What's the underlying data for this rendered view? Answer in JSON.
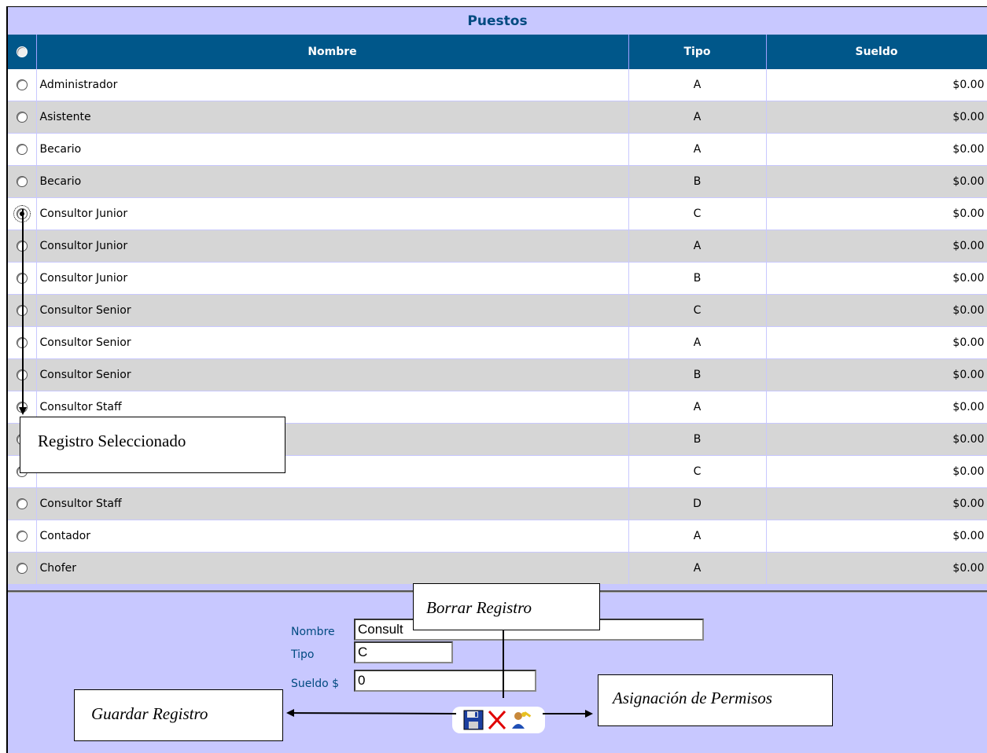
{
  "title": "Puestos",
  "columns": {
    "nombre": "Nombre",
    "tipo": "Tipo",
    "sueldo": "Sueldo"
  },
  "rows": [
    {
      "nombre": "Administrador",
      "tipo": "A",
      "sueldo": "$0.00"
    },
    {
      "nombre": "Asistente",
      "tipo": "A",
      "sueldo": "$0.00"
    },
    {
      "nombre": "Becario",
      "tipo": "A",
      "sueldo": "$0.00"
    },
    {
      "nombre": "Becario",
      "tipo": "B",
      "sueldo": "$0.00"
    },
    {
      "nombre": "Consultor Junior",
      "tipo": "C",
      "sueldo": "$0.00",
      "selected": true
    },
    {
      "nombre": "Consultor Junior",
      "tipo": "A",
      "sueldo": "$0.00"
    },
    {
      "nombre": "Consultor Junior",
      "tipo": "B",
      "sueldo": "$0.00"
    },
    {
      "nombre": "Consultor Senior",
      "tipo": "C",
      "sueldo": "$0.00"
    },
    {
      "nombre": "Consultor Senior",
      "tipo": "A",
      "sueldo": "$0.00"
    },
    {
      "nombre": "Consultor Senior",
      "tipo": "B",
      "sueldo": "$0.00"
    },
    {
      "nombre": "Consultor Staff",
      "tipo": "A",
      "sueldo": "$0.00"
    },
    {
      "nombre": "",
      "tipo": "B",
      "sueldo": "$0.00"
    },
    {
      "nombre": "",
      "tipo": "C",
      "sueldo": "$0.00"
    },
    {
      "nombre": "Consultor Staff",
      "tipo": "D",
      "sueldo": "$0.00"
    },
    {
      "nombre": "Contador",
      "tipo": "A",
      "sueldo": "$0.00"
    },
    {
      "nombre": "Chofer",
      "tipo": "A",
      "sueldo": "$0.00"
    }
  ],
  "form": {
    "nombre_label": "Nombre",
    "nombre_value": "Consult",
    "tipo_label": "Tipo",
    "tipo_value": "C",
    "sueldo_label": "Sueldo $",
    "sueldo_value": "0"
  },
  "actions": {
    "save_icon": "floppy-disk-icon",
    "delete_icon": "red-x-icon",
    "permissions_icon": "user-key-icon"
  },
  "callouts": {
    "selected": "Registro Seleccionado",
    "delete": "Borrar Registro",
    "save": "Guardar Registro",
    "permissions": "Asignación de Permisos"
  },
  "colors": {
    "header_bg": "#00578a",
    "panel_bg": "#c8c8ff",
    "row_alt": "#d6d6d6",
    "title_text": "#004a80"
  }
}
